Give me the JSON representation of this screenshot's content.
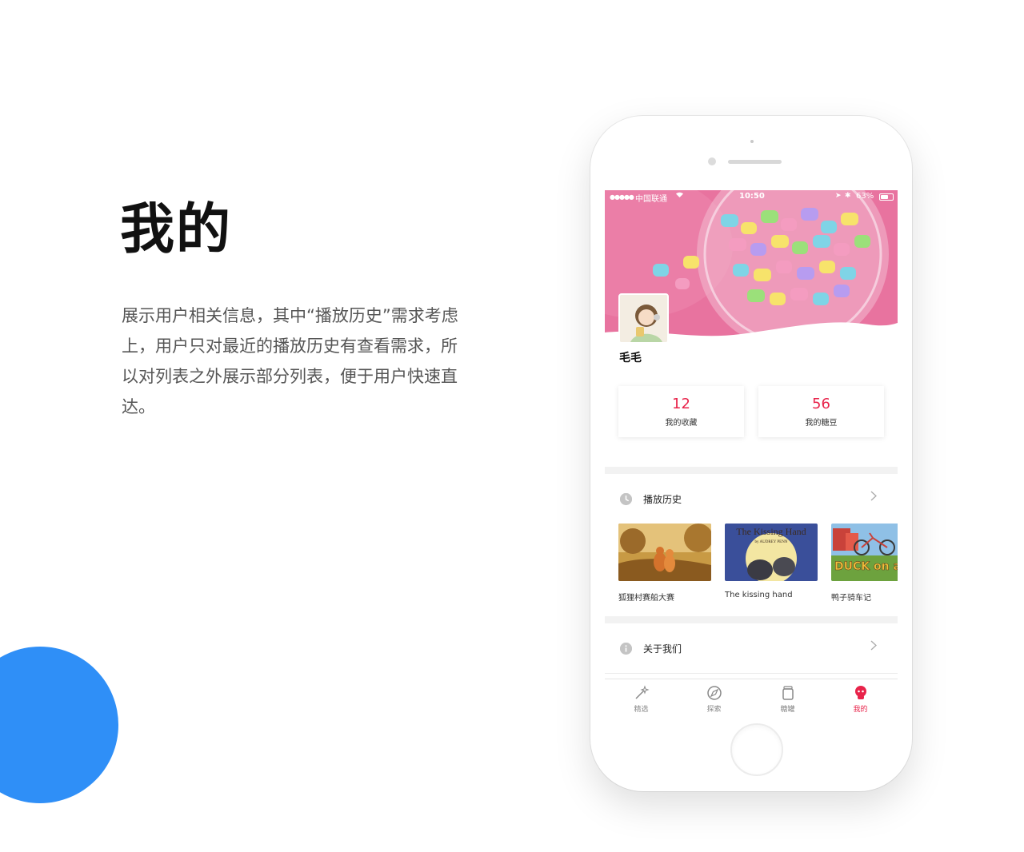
{
  "left": {
    "title": "我的",
    "description": "展示用户相关信息，其中“播放历史”需求考虑上，用户只对最近的播放历史有查看需求，所以对列表之外展示部分列表，便于用户快速直达。"
  },
  "status_bar": {
    "signal": "●●●●●",
    "carrier": "中国联通",
    "time": "10:50",
    "battery": "63%",
    "battery_level": 0.63
  },
  "profile": {
    "username": "毛毛",
    "stats": [
      {
        "value": "12",
        "label": "我的收藏"
      },
      {
        "value": "56",
        "label": "我的糖豆"
      }
    ]
  },
  "history": {
    "title": "播放历史",
    "books": [
      {
        "title": "狐狸村赛船大赛"
      },
      {
        "title": "The kissing hand",
        "cover_title": "The Kissing Hand",
        "cover_author": "by AUDREY PENN"
      },
      {
        "title": "鸭子骑车记",
        "cover_title": "DUCK on a BIKE"
      }
    ]
  },
  "about": {
    "label": "关于我们"
  },
  "tabbar": {
    "tabs": [
      {
        "label": "精选",
        "icon": "wand-icon",
        "active": false
      },
      {
        "label": "探索",
        "icon": "compass-icon",
        "active": false
      },
      {
        "label": "糖罐",
        "icon": "jar-icon",
        "active": false
      },
      {
        "label": "我的",
        "icon": "profile-icon",
        "active": true
      }
    ]
  },
  "colors": {
    "accent": "#e8234a",
    "circle": "#2f8ff7",
    "hero_pink": "#e8739f"
  }
}
